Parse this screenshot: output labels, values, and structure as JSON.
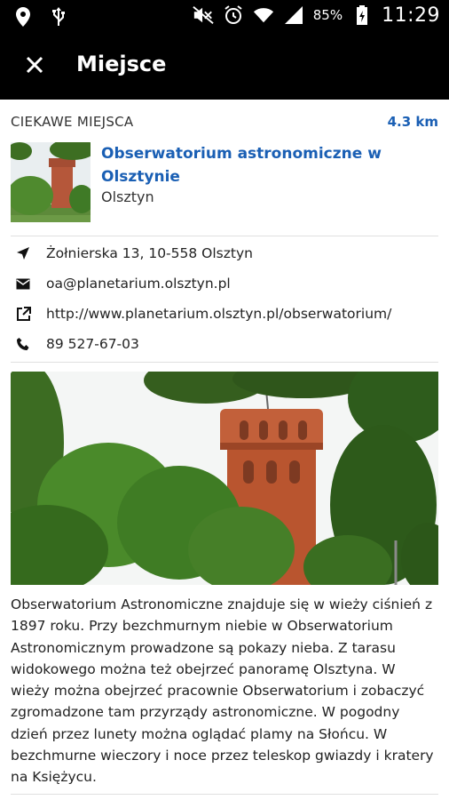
{
  "status_bar": {
    "time": "11:29",
    "battery": "85%",
    "icons": [
      "location-icon",
      "usb-icon",
      "mute-icon",
      "alarm-icon",
      "wifi-icon",
      "signal-icon",
      "battery-icon"
    ]
  },
  "app_bar": {
    "title": "Miejsce",
    "close_icon": "close-icon"
  },
  "place": {
    "category": "CIEKAWE MIEJSCA",
    "distance": "4.3 km",
    "name": "Obserwatorium astronomiczne w Olsztynie",
    "city": "Olsztyn"
  },
  "info": {
    "address": "Żołnierska 13, 10-558 Olsztyn",
    "email": "oa@planetarium.olsztyn.pl",
    "website": "http://www.planetarium.olsztyn.pl/obserwatorium/",
    "phone": "89 527-67-03"
  },
  "description": "Obserwatorium Astronomiczne znajduje się w wieży ciśnień z 1897 roku. Przy bezchmurnym niebie w Obserwatorium Astronomicznym prowadzone są pokazy nieba. Z tarasu widokowego można też obejrzeć panoramę Olsztyna. W wieży można obejrzeć pracownie Obserwatorium i zobaczyć zgromadzone tam przyrządy astronomiczne. W pogodny dzień przez lunety można oglądać plamy na Słońcu. W bezchmurne wieczory i noce przez teleskop gwiazdy i kratery na Księżycu.",
  "colors": {
    "accent": "#1a5fb4",
    "bar": "#000000"
  }
}
